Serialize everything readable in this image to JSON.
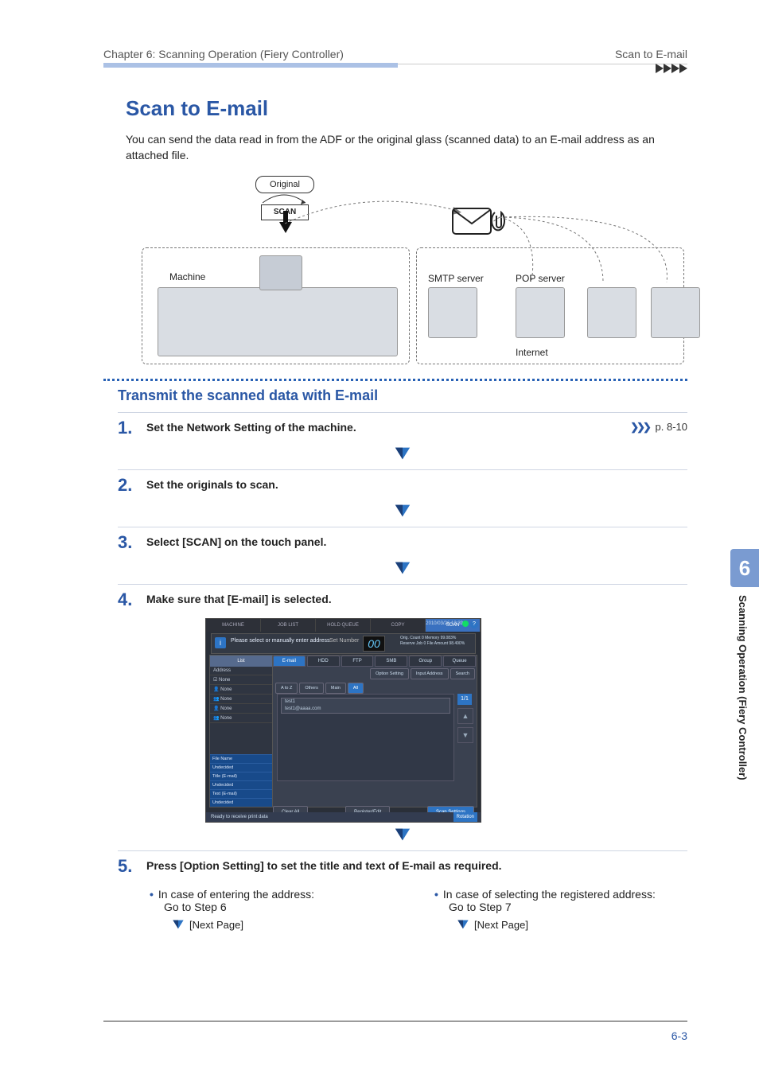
{
  "header": {
    "left": "Chapter 6: Scanning Operation (Fiery Controller)",
    "right": "Scan to E-mail"
  },
  "title": "Scan to E-mail",
  "intro": "You can send the data read in from the ADF or the original glass (scanned data) to an E-mail address as an attached file.",
  "diagram": {
    "original": "Original",
    "scan": "SCAN",
    "machine": "Machine",
    "smtp": "SMTP server",
    "pop": "POP server",
    "internet": "Internet"
  },
  "subhead": "Transmit the scanned data with E-mail",
  "steps": {
    "s1": {
      "num": "1",
      "text": "Set the Network Setting of the machine.",
      "ref": "p. 8-10"
    },
    "s2": {
      "num": "2",
      "text": "Set the originals to scan."
    },
    "s3": {
      "num": "3",
      "text": "Select [SCAN] on the touch panel."
    },
    "s4": {
      "num": "4",
      "text": "Make sure that [E-mail] is selected."
    },
    "s5": {
      "num": "5",
      "text": "Press [Option Setting] to set the title and text of E-mail as required."
    }
  },
  "screenshot": {
    "top_tabs": [
      "MACHINE",
      "JOB LIST",
      "HOLD QUEUE",
      "COPY",
      "SCAN"
    ],
    "datetime": "2010/03/26 13:39",
    "info_text": "Please select or manually enter address",
    "set_number_label": "Set Number",
    "set_number_value": "00",
    "mem_lines": [
      "Orig. Count    0  Memory    99.083%",
      "Reserve Job   0  File Amount 98.490%"
    ],
    "side_header": "List",
    "side_items": [
      "Address",
      "☑ None",
      "👤 None",
      "👥 None",
      "👤 None",
      "👥 None"
    ],
    "side_info": [
      "File Name",
      "Undecided",
      "Title (E-mail)",
      "Undecided",
      "Text (E-mail)",
      "Undecided"
    ],
    "dest_tabs": [
      "E-mail",
      "HDD",
      "FTP",
      "SMB",
      "Group",
      "Queue"
    ],
    "mid_buttons": [
      "Option Setting",
      "Input Address",
      "Search"
    ],
    "chips": [
      "A to Z",
      "Others",
      "Main",
      "All"
    ],
    "list_entry_name": "test1",
    "list_entry_addr": "test1@aaaa.com",
    "scroll_count": "1/1",
    "bottom_buttons": [
      "Clear All",
      "Register/Edit",
      "Scan Settings"
    ],
    "status": "Ready to receive print data",
    "rotation": "Rotation"
  },
  "bullets": {
    "left_a": "In case of entering the address:",
    "left_b": "Go to Step 6",
    "right_a": "In case of selecting the registered address:",
    "right_b": "Go to Step 7",
    "next_page": "[Next Page]"
  },
  "side": {
    "chapter": "6",
    "label": "Scanning Operation (Fiery Controller)"
  },
  "footer": "6-3"
}
